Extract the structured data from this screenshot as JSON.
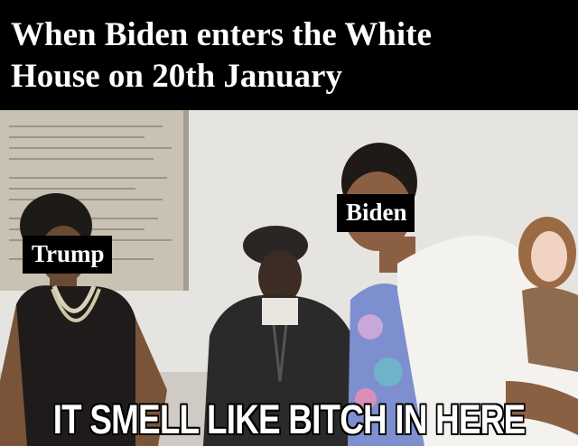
{
  "header": {
    "line1": "When Biden enters the White",
    "line2": "House on 20th January"
  },
  "labels": {
    "left": "Trump",
    "right": "Biden"
  },
  "caption": "IT SMELL LIKE BITCH IN HERE"
}
